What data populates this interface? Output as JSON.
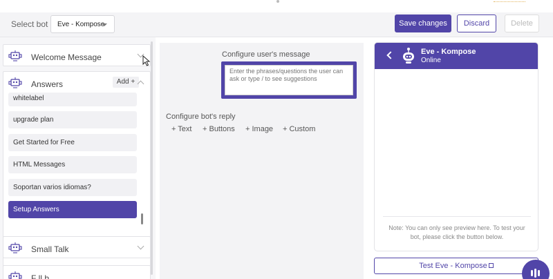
{
  "toolbar": {
    "select_label": "Select bot",
    "selected_bot": "Eve - Kompose",
    "save_label": "Save changes",
    "discard_label": "Discard",
    "delete_label": "Delete"
  },
  "sidebar": {
    "sections": {
      "welcome": "Welcome Message",
      "answers": "Answers",
      "small_talk": "Small Talk",
      "fallback_partial": "F  ll  b  "
    },
    "add_label": "Add +",
    "answer_items": [
      "whitelabel",
      "upgrade plan",
      "Get Started for Free",
      "HTML Messages",
      "Soportan varios idiomas?",
      "Setup Answers"
    ]
  },
  "editor": {
    "user_message_label": "Configure user's message",
    "user_message_placeholder": "Enter the phrases/questions the user can ask or type / to see suggestions",
    "bot_reply_label": "Configure bot's reply",
    "reply_options": [
      "+ Text",
      "+ Buttons",
      "+ Image",
      "+ Custom"
    ]
  },
  "preview": {
    "bot_name": "Eve - Kompose",
    "status": "Online",
    "note": "Note: You can only see preview here. To test your bot, please click the button below.",
    "test_label": "Test Eve - Kompose"
  },
  "colors": {
    "accent": "#5145a8",
    "panel_bg": "#f6f6f8"
  }
}
